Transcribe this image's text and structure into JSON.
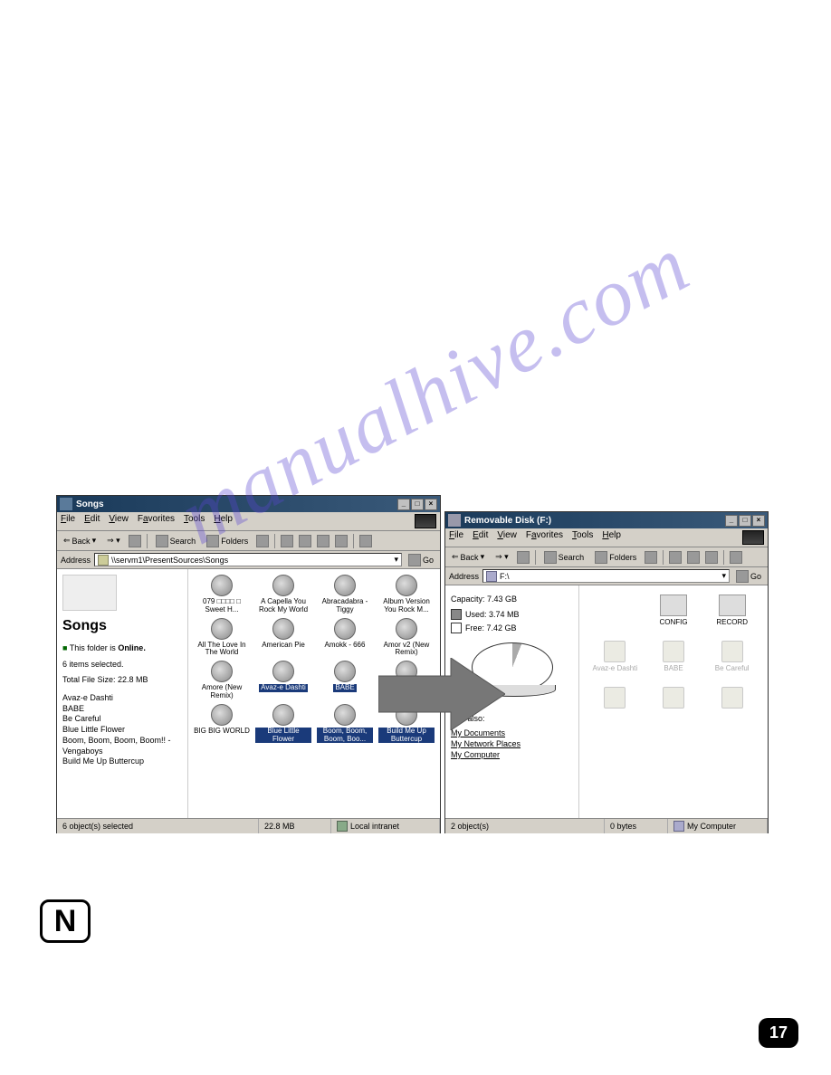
{
  "watermark": "manualhive.com",
  "page_number": "17",
  "badge": "N",
  "win1": {
    "title": "Songs",
    "menus": [
      "File",
      "Edit",
      "View",
      "Favorites",
      "Tools",
      "Help"
    ],
    "toolbar": {
      "back": "Back",
      "search": "Search",
      "folders": "Folders"
    },
    "address_label": "Address",
    "address_value": "\\\\servm1\\PresentSources\\Songs",
    "go": "Go",
    "sidebar": {
      "heading": "Songs",
      "online_prefix": "This folder is ",
      "online_bold": "Online.",
      "items_selected": "6 items selected.",
      "total_size": "Total File Size: 22.8 MB",
      "files": [
        "Avaz-e Dashti",
        "BABE",
        "Be Careful",
        "Blue Little Flower",
        "Boom, Boom, Boom, Boom!! - Vengaboys",
        "Build Me Up Buttercup"
      ]
    },
    "items": [
      {
        "label": "079 □□□□ □ Sweet H...",
        "sel": false
      },
      {
        "label": "A Capella You Rock My World",
        "sel": false
      },
      {
        "label": "Abracadabra - Tiggy",
        "sel": false
      },
      {
        "label": "Album Version You Rock M...",
        "sel": false
      },
      {
        "label": "All The Love In The World",
        "sel": false
      },
      {
        "label": "American Pie",
        "sel": false
      },
      {
        "label": "Amokk - 666",
        "sel": false
      },
      {
        "label": "Amor v2 (New Remix)",
        "sel": false
      },
      {
        "label": "Amore (New Remix)",
        "sel": false
      },
      {
        "label": "Avaz-e Dashti",
        "sel": true
      },
      {
        "label": "BABE",
        "sel": true
      },
      {
        "label": "Be Careful",
        "sel": true
      },
      {
        "label": "BIG BIG WORLD",
        "sel": false
      },
      {
        "label": "Blue Little Flower",
        "sel": true
      },
      {
        "label": "Boom, Boom, Boom, Boo...",
        "sel": true
      },
      {
        "label": "Build Me Up Buttercup",
        "sel": true
      }
    ],
    "status": {
      "selected": "6 object(s) selected",
      "size": "22.8 MB",
      "zone": "Local intranet"
    }
  },
  "win2": {
    "title": "Removable Disk (F:)",
    "menus": [
      "File",
      "Edit",
      "View",
      "Favorites",
      "Tools",
      "Help"
    ],
    "toolbar": {
      "back": "Back",
      "search": "Search",
      "folders": "Folders"
    },
    "address_label": "Address",
    "address_value": "F:\\",
    "go": "Go",
    "sidebar": {
      "capacity": "Capacity: 7.43 GB",
      "used": "Used: 3.74 MB",
      "free": "Free: 7.42 GB",
      "see_also": "See also:",
      "links": [
        "My Documents",
        "My Network Places",
        "My Computer"
      ]
    },
    "folders": [
      "CONFIG",
      "RECORD"
    ],
    "ghost_items": [
      "Avaz-e Dashti",
      "BABE",
      "Be Careful",
      "",
      "",
      ""
    ],
    "status": {
      "objects": "2 object(s)",
      "size": "0 bytes",
      "zone": "My Computer"
    }
  }
}
